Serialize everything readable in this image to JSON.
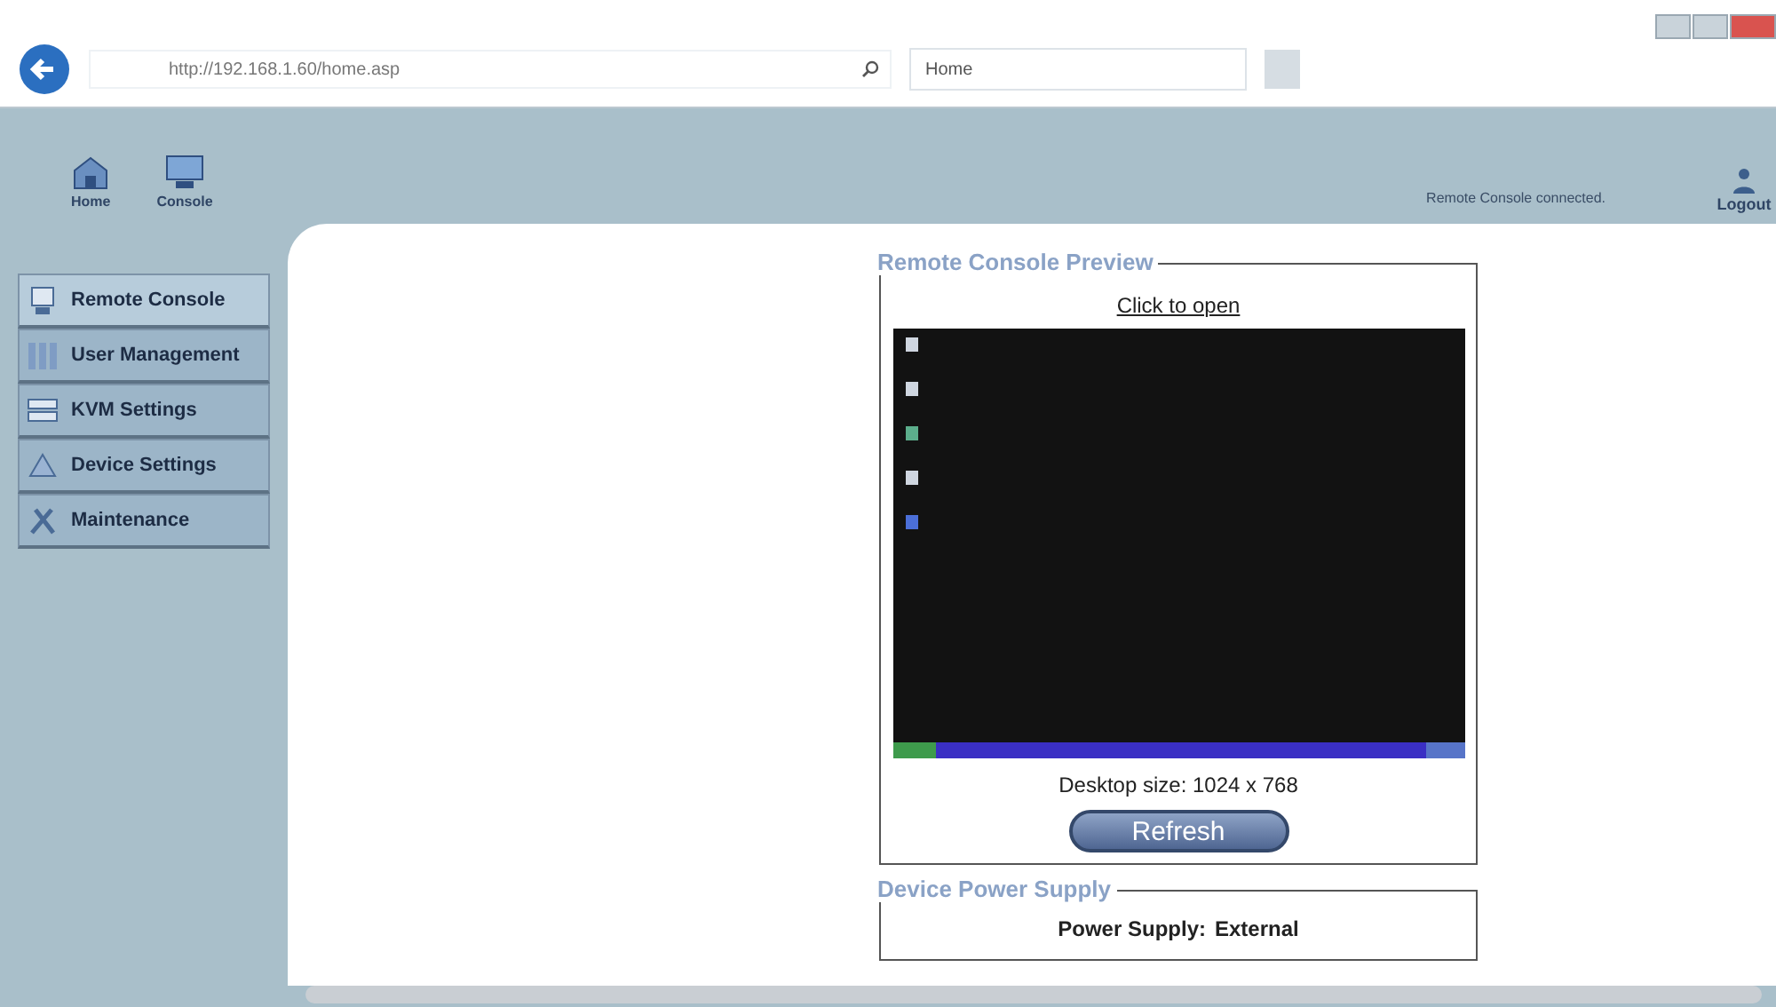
{
  "browser": {
    "address": "http://192.168.1.60/home.asp",
    "tab_title": "Home"
  },
  "toolbar": {
    "items": [
      {
        "label": "Home",
        "kind": "home"
      },
      {
        "label": "Console",
        "kind": "console"
      }
    ],
    "status": "Remote Console connected.",
    "logout": "Logout"
  },
  "sidebar": {
    "items": [
      {
        "label": "Remote Console",
        "kind": "console",
        "selected": true
      },
      {
        "label": "User Management",
        "kind": "users",
        "selected": false
      },
      {
        "label": "KVM Settings",
        "kind": "kvm",
        "selected": false
      },
      {
        "label": "Device Settings",
        "kind": "device",
        "selected": false
      },
      {
        "label": "Maintenance",
        "kind": "tools",
        "selected": false
      }
    ]
  },
  "preview": {
    "legend": "Remote Console Preview",
    "link": "Click to open",
    "desktop_size": "Desktop size: 1024 x 768",
    "button": "Refresh"
  },
  "power": {
    "legend": "Device Power Supply",
    "label": "Power Supply:",
    "value": "External"
  }
}
